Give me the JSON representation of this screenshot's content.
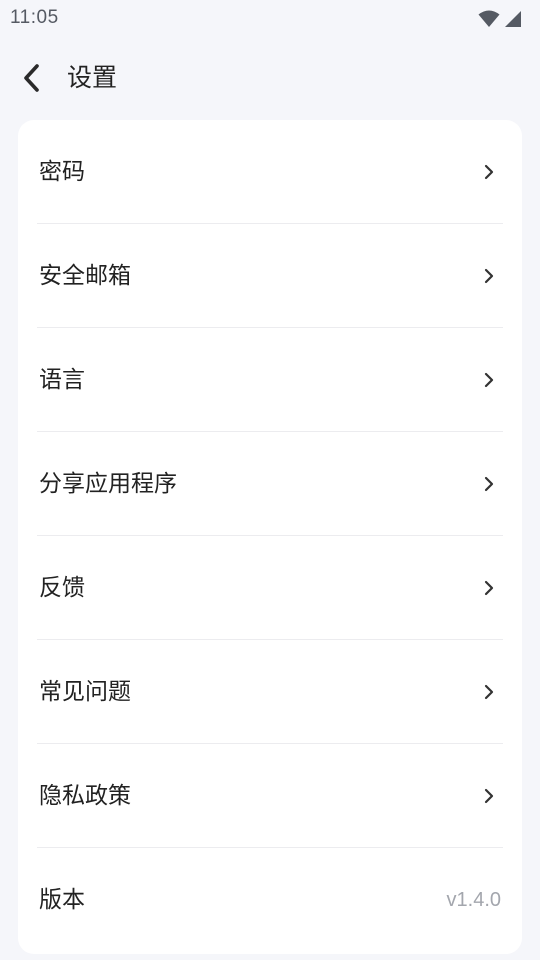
{
  "status_bar": {
    "time": "11:05",
    "icons": [
      "wifi-icon",
      "cell-signal-icon"
    ]
  },
  "header": {
    "back_icon": "chevron-left-icon",
    "title": "设置"
  },
  "settings": {
    "items": [
      {
        "label": "密码",
        "icon": "chevron-right-icon"
      },
      {
        "label": "安全邮箱",
        "icon": "chevron-right-icon"
      },
      {
        "label": "语言",
        "icon": "chevron-right-icon"
      },
      {
        "label": "分享应用程序",
        "icon": "chevron-right-icon"
      },
      {
        "label": "反馈",
        "icon": "chevron-right-icon"
      },
      {
        "label": "常见问题",
        "icon": "chevron-right-icon"
      },
      {
        "label": "隐私政策",
        "icon": "chevron-right-icon"
      }
    ],
    "version": {
      "label": "版本",
      "value": "v1.4.0"
    }
  },
  "colors": {
    "background": "#f5f6fa",
    "card": "#ffffff",
    "text": "#222222",
    "secondary_text": "#a3a6ad",
    "divider": "#ececef"
  }
}
